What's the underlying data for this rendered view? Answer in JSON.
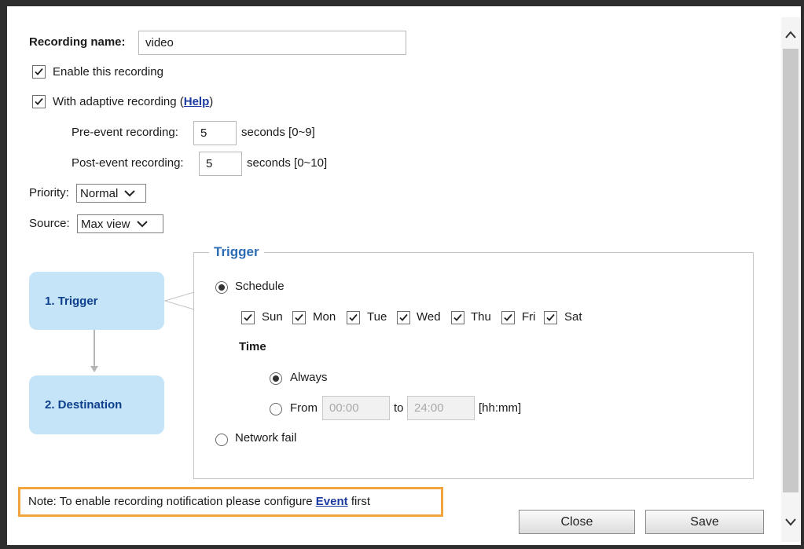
{
  "recording": {
    "name_label": "Recording name:",
    "name_value": "video",
    "enable_label": "Enable this recording",
    "enable_checked": true,
    "adaptive_prefix": "With adaptive recording (",
    "adaptive_help": "Help",
    "adaptive_suffix": ")",
    "adaptive_checked": true,
    "pre_event_label": "Pre-event recording:",
    "pre_event_value": "5",
    "pre_event_unit": "seconds [0~9]",
    "post_event_label": "Post-event recording:",
    "post_event_value": "5",
    "post_event_unit": "seconds [0~10]",
    "priority_label": "Priority:",
    "priority_value": "Normal",
    "source_label": "Source:",
    "source_value": "Max view"
  },
  "steps": [
    {
      "label": "1. Trigger"
    },
    {
      "label": "2. Destination"
    }
  ],
  "trigger": {
    "title": "Trigger",
    "schedule_label": "Schedule",
    "schedule_selected": true,
    "days": [
      {
        "label": "Sun",
        "checked": true
      },
      {
        "label": "Mon",
        "checked": true
      },
      {
        "label": "Tue",
        "checked": true
      },
      {
        "label": "Wed",
        "checked": true
      },
      {
        "label": "Thu",
        "checked": true
      },
      {
        "label": "Fri",
        "checked": true
      },
      {
        "label": "Sat",
        "checked": true
      }
    ],
    "time_label": "Time",
    "always_label": "Always",
    "always_selected": true,
    "from_label": "From",
    "from_value": "00:00",
    "to_label": "to",
    "to_value": "24:00",
    "format_label": "[hh:mm]",
    "network_fail_label": "Network fail"
  },
  "note": {
    "prefix": "Note: To enable recording notification please configure ",
    "link": "Event",
    "suffix": " first"
  },
  "buttons": {
    "close": "Close",
    "save": "Save"
  },
  "colors": {
    "highlight_border": "#f2a53a",
    "step_bg": "#c5e4f8",
    "trigger_title": "#2b6cb5"
  }
}
